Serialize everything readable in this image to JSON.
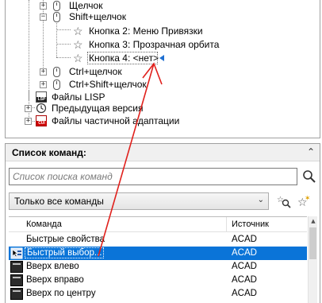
{
  "tree": {
    "items": [
      {
        "label": "Щелчок",
        "icon": "mouse-icon"
      },
      {
        "label": "Shift+щелчок",
        "icon": "mouse-icon"
      },
      {
        "label": "Кнопка 2: Меню Привязки",
        "icon": "star-icon"
      },
      {
        "label": "Кнопка 3: Прозрачная орбита",
        "icon": "star-icon"
      },
      {
        "label": "Кнопка 4: <нет>",
        "icon": "star-icon"
      },
      {
        "label": "Ctrl+щелчок",
        "icon": "mouse-icon"
      },
      {
        "label": "Ctrl+Shift+щелчок",
        "icon": "mouse-icon"
      },
      {
        "label": "Файлы LISP",
        "icon": "lsp-file-icon"
      },
      {
        "label": "Предыдущая версия",
        "icon": "history-icon"
      },
      {
        "label": "Файлы частичной адаптации",
        "icon": "cui-file-icon"
      }
    ],
    "icon_text": {
      "lsp": "LSP",
      "cui": "CUI"
    }
  },
  "command_panel": {
    "title": "Список команд:",
    "search_placeholder": "Список поиска команд",
    "filter_value": "Только все команды",
    "columns": {
      "command": "Команда",
      "source": "Источник"
    },
    "rows": [
      {
        "name": "Быстрые свойства",
        "source": "ACAD",
        "icon": "none",
        "selected": false
      },
      {
        "name": "Быстрый выбор...",
        "source": "ACAD",
        "icon": "quick-select-icon",
        "selected": true
      },
      {
        "name": "Вверх влево",
        "source": "ACAD",
        "icon": "command-icon",
        "selected": false
      },
      {
        "name": "Вверх вправо",
        "source": "ACAD",
        "icon": "command-icon",
        "selected": false
      },
      {
        "name": "Вверх по центру",
        "source": "ACAD",
        "icon": "command-icon",
        "selected": false
      }
    ]
  },
  "colors": {
    "selection": "#0a74d8",
    "annotation_arrow": "#e0201c",
    "marker": "#1f6fd1"
  }
}
